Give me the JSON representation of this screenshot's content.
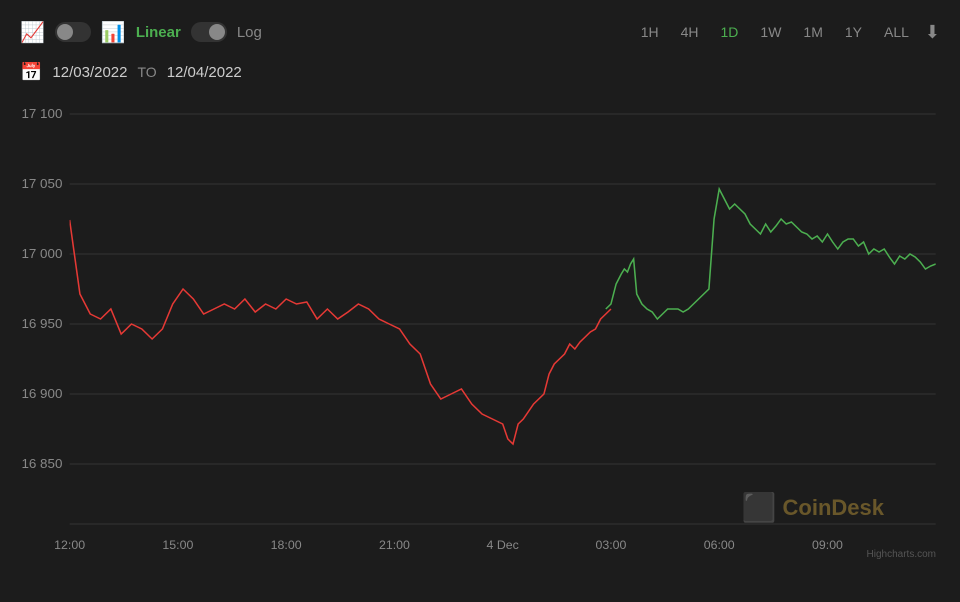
{
  "toolbar": {
    "chart_type_icon": "📈",
    "linear_label": "Linear",
    "log_label": "Log",
    "time_buttons": [
      "1H",
      "4H",
      "1D",
      "1W",
      "1M",
      "1Y",
      "ALL"
    ],
    "active_time": "1D"
  },
  "date_range": {
    "from": "12/03/2022",
    "to_label": "TO",
    "to": "12/04/2022"
  },
  "chart": {
    "y_labels": [
      "17 100",
      "17 050",
      "17 000",
      "16 950",
      "16 900",
      "16 850"
    ],
    "x_labels": [
      "12:00",
      "15:00",
      "18:00",
      "21:00",
      "4 Dec",
      "03:00",
      "06:00",
      "09:00"
    ],
    "y_min": 16840,
    "y_max": 17110
  },
  "watermark": {
    "coindesk_label": "CoinDesk"
  },
  "highcharts_credit": "Highcharts.com"
}
